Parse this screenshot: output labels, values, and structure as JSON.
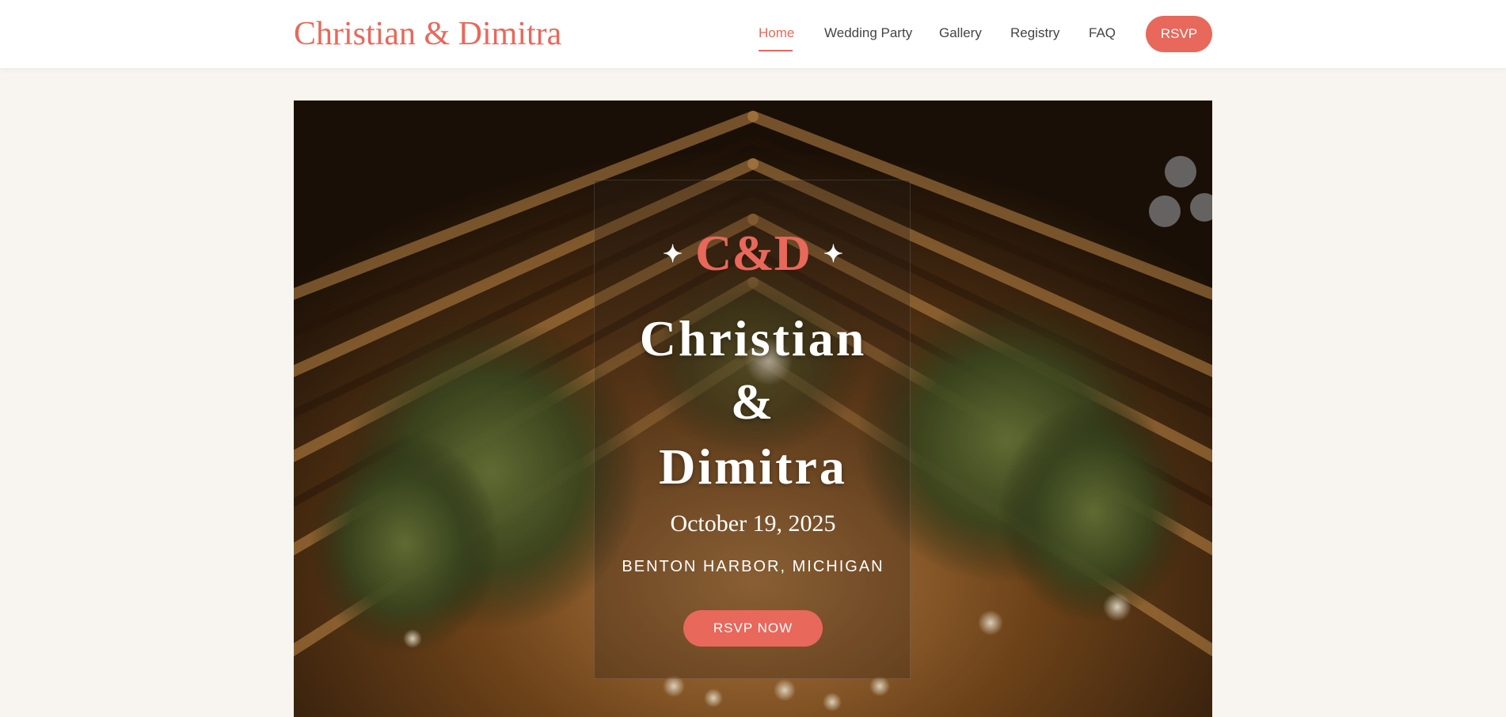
{
  "header": {
    "brand": "Christian & Dimitra",
    "nav": [
      {
        "label": "Home",
        "active": true
      },
      {
        "label": "Wedding Party",
        "active": false
      },
      {
        "label": "Gallery",
        "active": false
      },
      {
        "label": "Registry",
        "active": false
      },
      {
        "label": "FAQ",
        "active": false
      }
    ],
    "rsvp_label": "RSVP"
  },
  "hero": {
    "monogram": "C&D",
    "sparkle": "✦",
    "name_first": "Christian",
    "ampersand": "&",
    "name_second": "Dimitra",
    "date": "October 19, 2025",
    "location": "BENTON HARBOR, MICHIGAN",
    "cta_label": "RSVP NOW",
    "background_description_icon": "barn-rafters-greenery-photo"
  },
  "colors": {
    "accent": "#e8685b",
    "page_background": "#f8f5f0",
    "header_background": "#ffffff"
  }
}
